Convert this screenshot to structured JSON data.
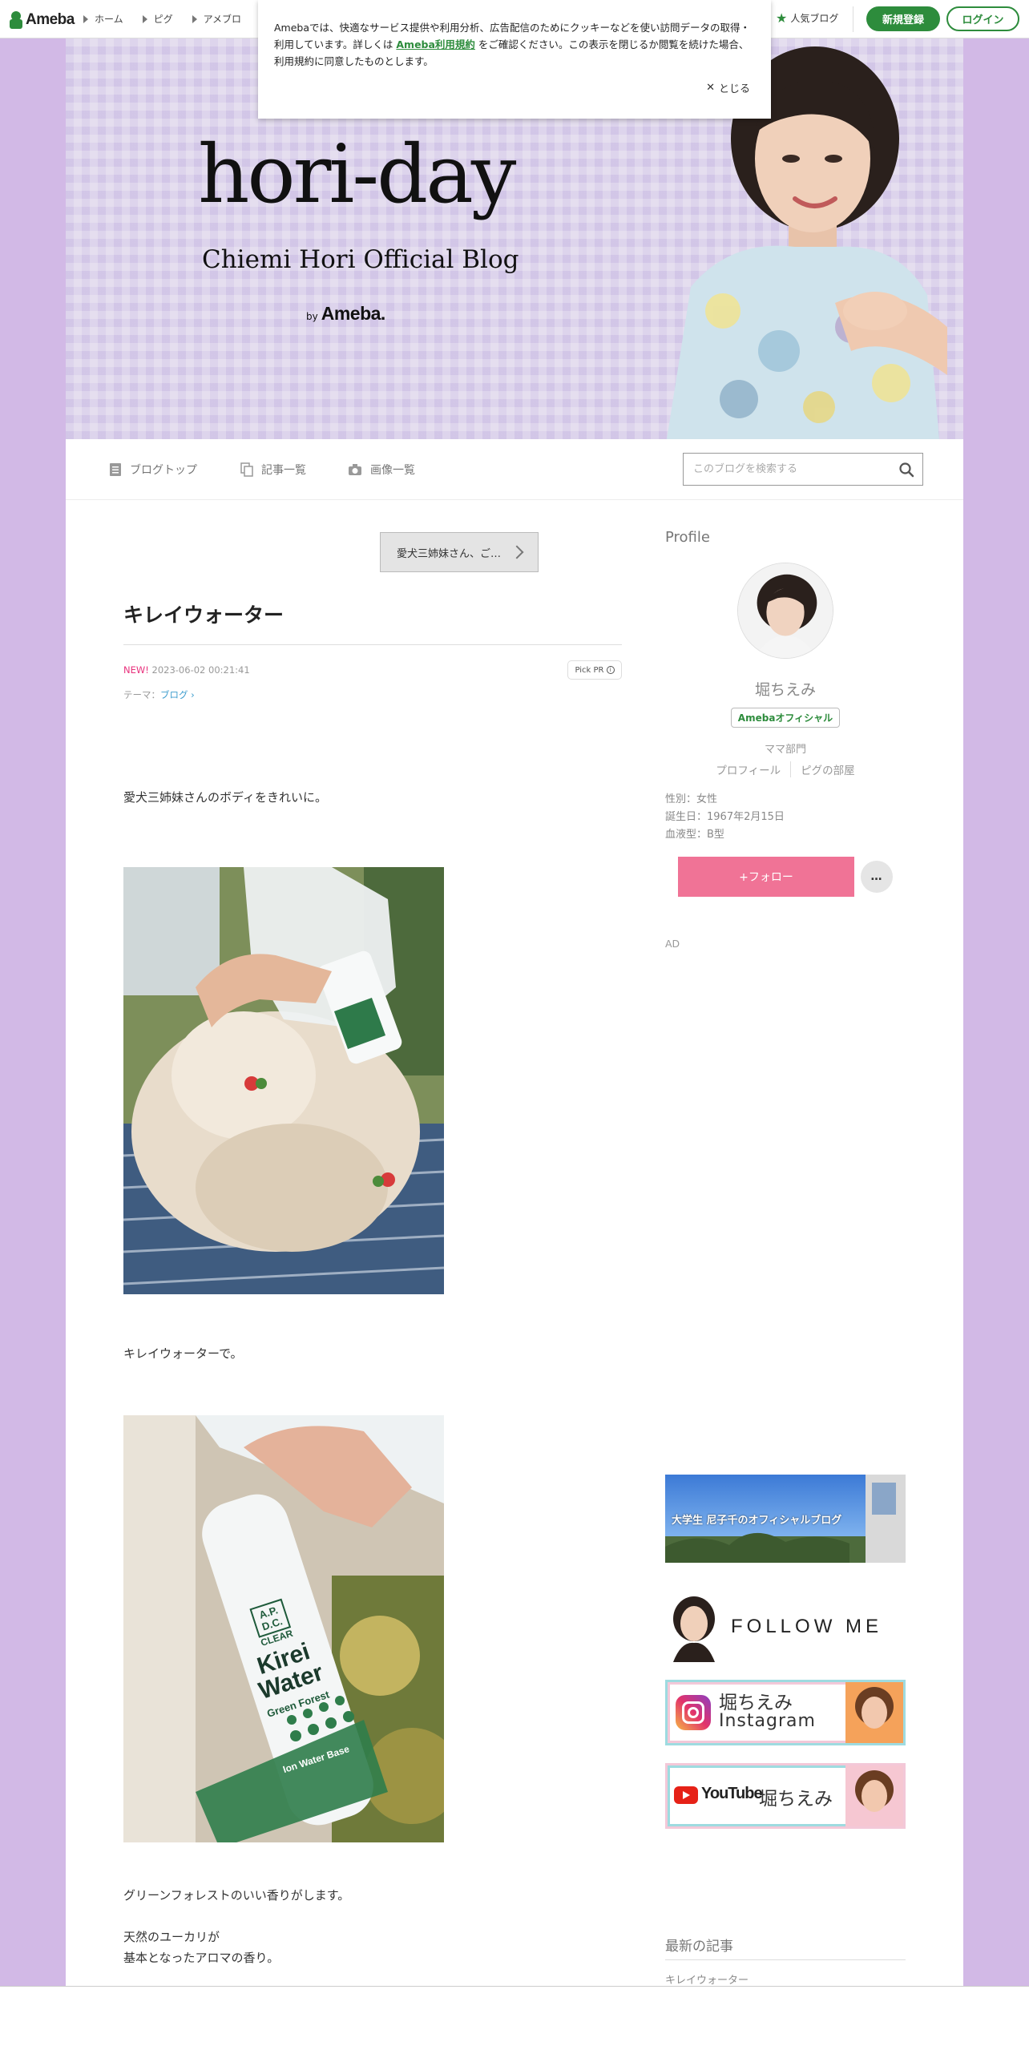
{
  "global_nav": {
    "logo": "Ameba",
    "items": [
      "ホーム",
      "ピグ",
      "アメブロ"
    ],
    "popular": "人気ブログ",
    "register": "新規登録",
    "login": "ログイン"
  },
  "cookie": {
    "text_before": "Amebaでは、快適なサービス提供や利用分析、広告配信のためにクッキーなどを使い訪問データの取得・利用しています。詳しくは",
    "link": "Ameba利用規約",
    "text_after": "をご確認ください。この表示を閉じるか閲覧を続けた場合、利用規約に同意したものとします。",
    "close": "とじる"
  },
  "header": {
    "title": "hori-day",
    "subtitle": "Chiemi Hori Official Blog",
    "by": "by",
    "brand": "Ameba."
  },
  "blog_menu": {
    "top": "ブログトップ",
    "entries": "記事一覧",
    "images": "画像一覧",
    "search_placeholder": "このブログを検索する"
  },
  "entry": {
    "prev_label": "愛犬三姉妹さん、ご…",
    "title": "キレイウォーター",
    "new_badge": "NEW!",
    "datetime": "2023-06-02 00:21:41",
    "pickpr": "Pick PR",
    "theme_label": "テーマ：",
    "theme": "ブログ",
    "para1": "愛犬三姉妹さんのボディをきれいに。",
    "para2": "キレイウォーターで。",
    "para3": "グリーンフォレストのいい香りがします。",
    "para4a": "天然のユーカリが",
    "para4b": "基本となったアロマの香り。"
  },
  "product_label": {
    "brand1": "A.P.",
    "brand2": "D.C.",
    "brand3": "CLEAR",
    "name1": "Kirei",
    "name2": "Water",
    "variant": "Green Forest",
    "base": "Ion Water Base"
  },
  "sidebar": {
    "profile_heading": "Profile",
    "name": "堀ちえみ",
    "official": "Amebaオフィシャル",
    "genre": "ママ部門",
    "links": [
      "プロフィール",
      "ピグの部屋"
    ],
    "gender": "性別：女性",
    "birthday": "誕生日：1967年2月15日",
    "blood": "血液型：B型",
    "follow": "+フォロー",
    "more": "…",
    "ad": "AD",
    "banner_daigaku": "大学生 尼子千のオフィシャルブログ",
    "banner_follow": "FOLLOW ME",
    "banner_insta_name": "堀ちえみ",
    "banner_insta_service": "Instagram",
    "banner_yt_service": "YouTube",
    "banner_yt_name": "堀ちえみ",
    "recent_heading": "最新の記事",
    "recent_item": "キレイウォーター"
  },
  "colors": {
    "ameba_green": "#2d8c3c",
    "follow_pink": "#f07396",
    "page_lavender": "#d2b9e6",
    "new_pink": "#e8317c"
  }
}
